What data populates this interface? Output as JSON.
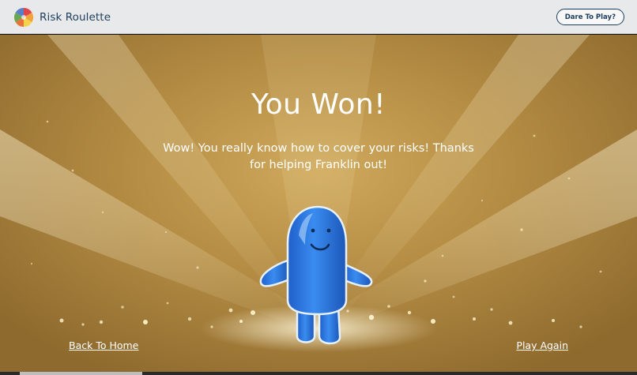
{
  "header": {
    "app_name": "Risk Roulette",
    "logo_icon": "color-wheel-icon",
    "cta_label": "Dare To Play?"
  },
  "result": {
    "title": "You Won!",
    "message": "Wow! You really know how to cover your risks! Thanks for helping Franklin out!",
    "mascot_icon": "blue-blob-mascot"
  },
  "actions": {
    "back_label": "Back To Home",
    "play_again_label": "Play Again"
  },
  "colors": {
    "header_bg": "#e8e9ea",
    "brand_text": "#1d3d5c",
    "stage_gold": "#b58d44",
    "mascot_blue": "#2f7ee0"
  }
}
